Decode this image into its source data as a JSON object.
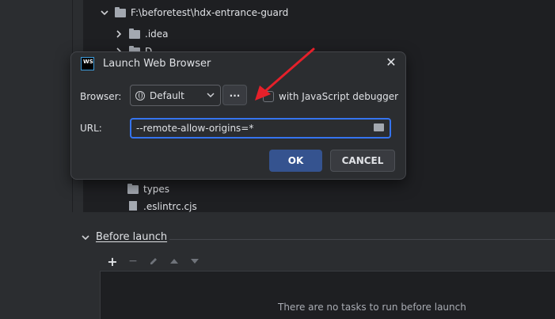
{
  "tree": {
    "root_label": "F:\\beforetest\\hdx-entrance-guard",
    "idea_label": ".idea",
    "partial_label": "D",
    "types_label": "types",
    "eslintrc_label": ".eslintrc.cjs"
  },
  "dialog": {
    "logo_text": "WS",
    "title": "Launch Web Browser",
    "browser_label": "Browser:",
    "browser_value": "Default",
    "dots_label": "...",
    "debugger_label": "with JavaScript debugger",
    "url_label": "URL:",
    "url_value": "--remote-allow-origins=*",
    "ok_label": "OK",
    "cancel_label": "CANCEL"
  },
  "before_launch": {
    "title": "Before launch",
    "empty_text": "There are no tasks to run before launch"
  },
  "colors": {
    "accent": "#3574f0",
    "annotation_arrow": "#e5202a",
    "ok_button": "#35538f"
  }
}
